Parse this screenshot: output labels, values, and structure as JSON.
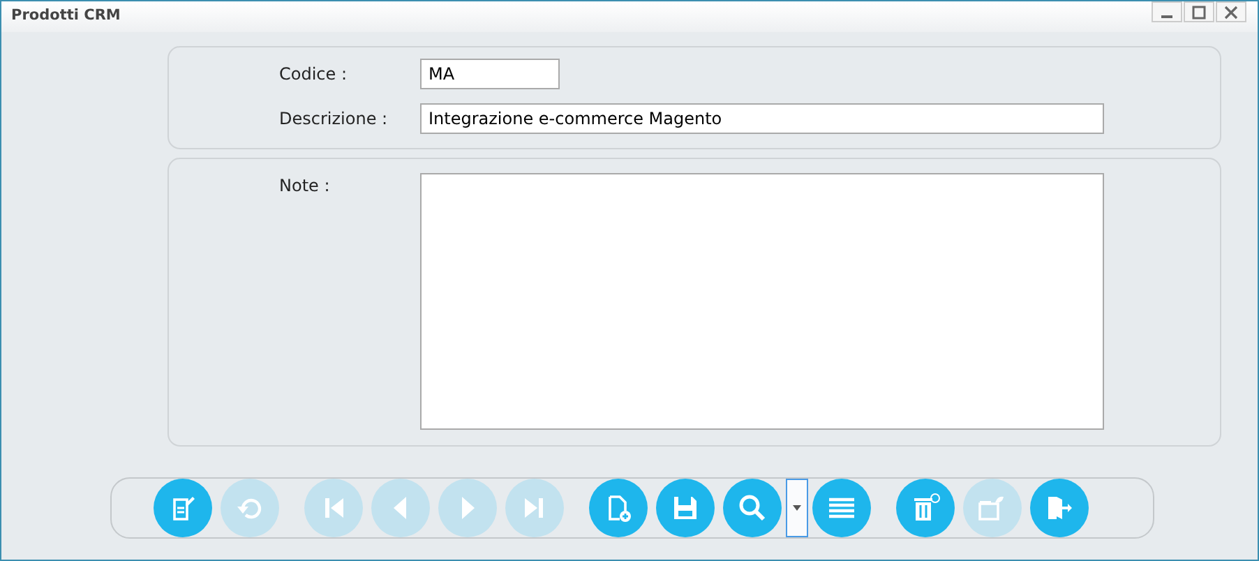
{
  "window": {
    "title": "Prodotti CRM"
  },
  "fields": [
    {
      "label": "Codice :",
      "value": "MA",
      "kind": "short"
    },
    {
      "label": "Descrizione :",
      "value": "Integrazione e-commerce Magento",
      "kind": "long"
    }
  ],
  "note": {
    "label": "Note :"
  },
  "toolbar": [
    [
      {
        "kind": "edit",
        "disabled": false
      },
      {
        "kind": "undo",
        "disabled": true
      }
    ],
    [
      {
        "kind": "first",
        "disabled": true
      },
      {
        "kind": "prev",
        "disabled": true
      },
      {
        "kind": "next",
        "disabled": true
      },
      {
        "kind": "last",
        "disabled": true
      }
    ],
    [
      {
        "kind": "new",
        "disabled": false
      },
      {
        "kind": "save",
        "disabled": false
      },
      {
        "kind": "search",
        "disabled": false
      },
      {
        "kind": "dropdown",
        "disabled": false
      },
      {
        "kind": "list",
        "disabled": false
      }
    ],
    [
      {
        "kind": "delete",
        "disabled": false
      },
      {
        "kind": "export",
        "disabled": true
      },
      {
        "kind": "exit",
        "disabled": false
      }
    ]
  ]
}
